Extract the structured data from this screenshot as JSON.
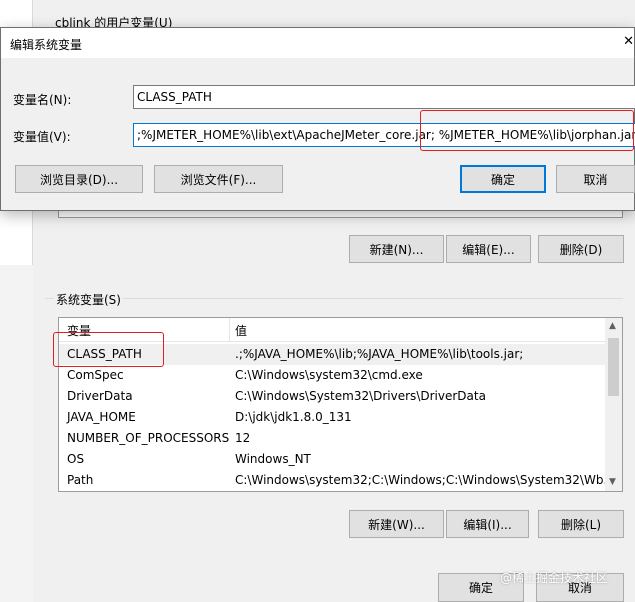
{
  "bg_window": {
    "title_peek": "cblink 的用户变量(U)",
    "user_buttons": {
      "new": "新建(N)...",
      "edit": "编辑(E)...",
      "delete": "删除(D)"
    },
    "system_group_label": "系统变量(S)",
    "columns": {
      "name": "变量",
      "value": "值"
    },
    "rows": [
      {
        "name": "CLASS_PATH",
        "value": ".;%JAVA_HOME%\\lib;%JAVA_HOME%\\lib\\tools.jar;"
      },
      {
        "name": "ComSpec",
        "value": "C:\\Windows\\system32\\cmd.exe"
      },
      {
        "name": "DriverData",
        "value": "C:\\Windows\\System32\\Drivers\\DriverData"
      },
      {
        "name": "JAVA_HOME",
        "value": "D:\\jdk\\jdk1.8.0_131"
      },
      {
        "name": "NUMBER_OF_PROCESSORS",
        "value": "12"
      },
      {
        "name": "OS",
        "value": "Windows_NT"
      },
      {
        "name": "Path",
        "value": "C:\\Windows\\system32;C:\\Windows;C:\\Windows\\System32\\Wb..."
      }
    ],
    "system_buttons": {
      "new": "新建(W)...",
      "edit": "编辑(I)...",
      "delete": "删除(L)"
    },
    "footer_buttons": {
      "ok": "确定",
      "cancel": "取消"
    }
  },
  "dialog": {
    "title": "编辑系统变量",
    "name_label": "变量名(N):",
    "name_value": "CLASS_PATH",
    "value_label": "变量值(V):",
    "value_value": ";%JMETER_HOME%\\lib\\ext\\ApacheJMeter_core.jar; %JMETER_HOME%\\lib\\jorphan.jar;",
    "browse_dir": "浏览目录(D)...",
    "browse_file": "浏览文件(F)...",
    "ok": "确定",
    "cancel": "取消"
  },
  "watermark": "@稀土掘金技术社区",
  "colors": {
    "annotation": "#e02020",
    "focus": "#0078d7"
  }
}
